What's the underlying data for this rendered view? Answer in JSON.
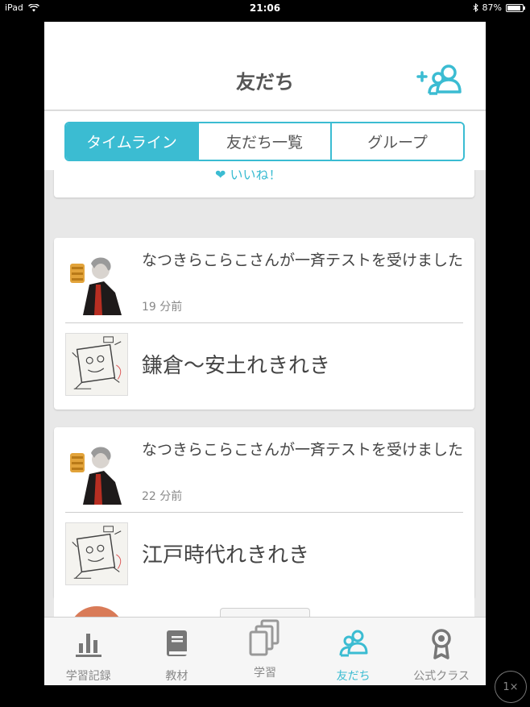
{
  "status_bar": {
    "device": "iPad",
    "time": "21:06",
    "battery": "87%",
    "battery_level": 0.87
  },
  "nav": {
    "title": "友だち",
    "add_friend_icon": "add-friend-icon"
  },
  "segments": [
    {
      "label": "タイムライン",
      "active": true
    },
    {
      "label": "友だち一覧",
      "active": false
    },
    {
      "label": "グループ",
      "active": false
    }
  ],
  "partial_top": {
    "like_label": "いいね！"
  },
  "feed": [
    {
      "message": "なつきらこらこさんが一斉テストを受けました",
      "time": "19 分前",
      "test_title": "鎌倉〜安土れきれき"
    },
    {
      "message": "なつきらこらこさんが一斉テストを受けました",
      "time": "22 分前",
      "test_title": "江戸時代れきれき"
    }
  ],
  "tabs": [
    {
      "label": "学習記録",
      "icon": "bar-chart-icon"
    },
    {
      "label": "教材",
      "icon": "book-icon"
    },
    {
      "label": "学習",
      "icon": "cards-icon"
    },
    {
      "label": "友だち",
      "icon": "friends-icon",
      "active": true
    },
    {
      "label": "公式クラス",
      "icon": "ribbon-icon"
    }
  ],
  "zoom_button": "1×",
  "colors": {
    "accent": "#3bbcd2",
    "text": "#444444",
    "muted": "#888888"
  }
}
